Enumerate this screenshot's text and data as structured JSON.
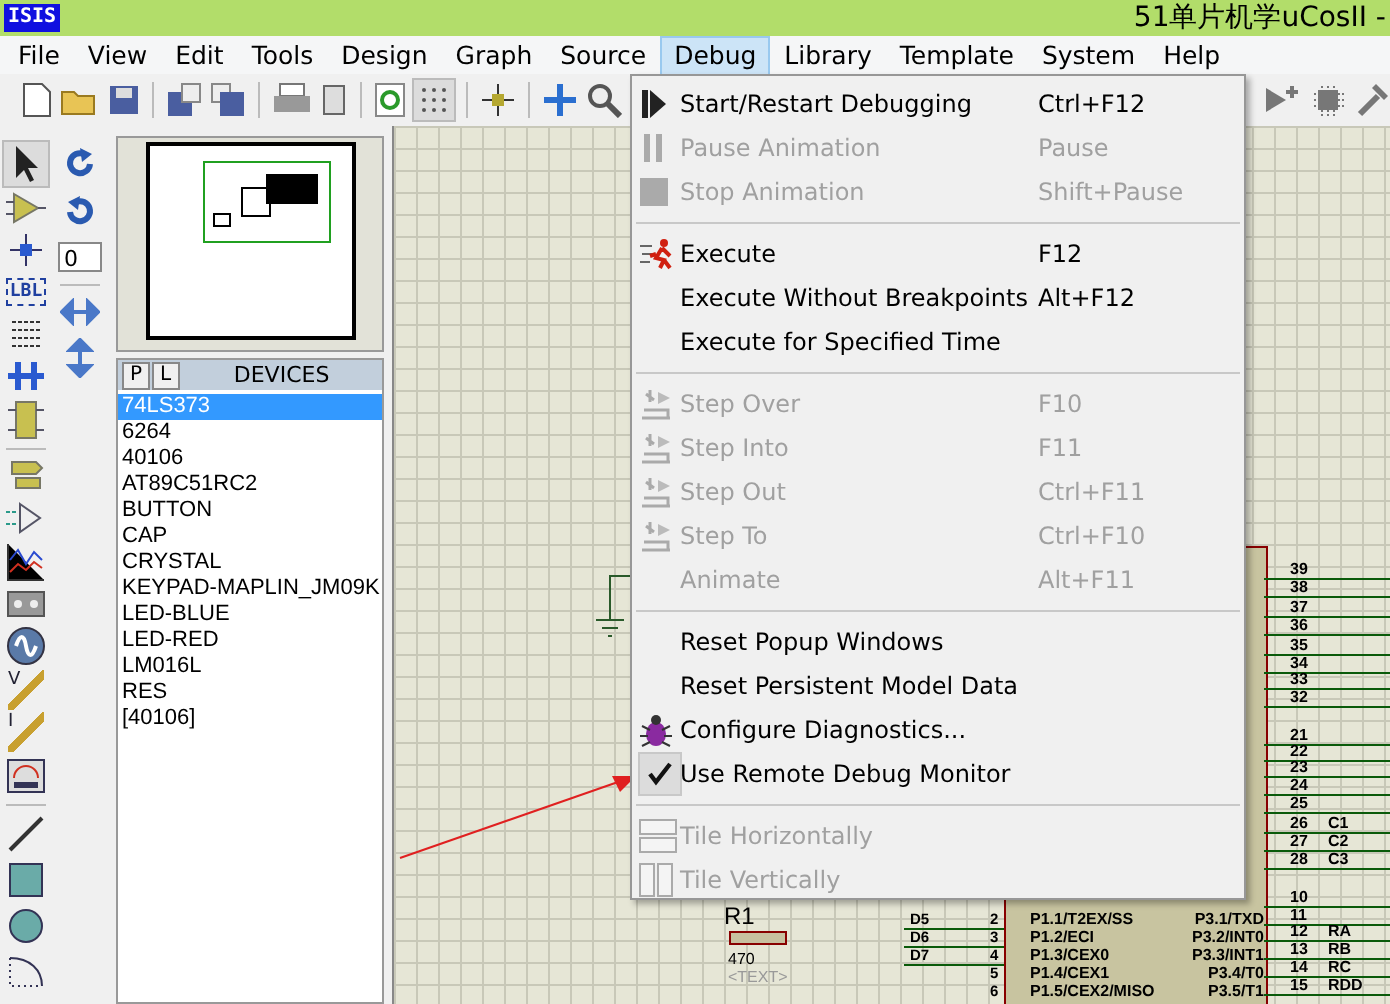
{
  "window": {
    "logo": "ISIS",
    "title": "51单片机学uCosII -"
  },
  "menus": [
    {
      "label": "File",
      "selected": false
    },
    {
      "label": "View",
      "selected": false
    },
    {
      "label": "Edit",
      "selected": false
    },
    {
      "label": "Tools",
      "selected": false
    },
    {
      "label": "Design",
      "selected": false
    },
    {
      "label": "Graph",
      "selected": false
    },
    {
      "label": "Source",
      "selected": false
    },
    {
      "label": "Debug",
      "selected": true
    },
    {
      "label": "Library",
      "selected": false
    },
    {
      "label": "Template",
      "selected": false
    },
    {
      "label": "System",
      "selected": false
    },
    {
      "label": "Help",
      "selected": false
    }
  ],
  "debug_menu": [
    {
      "kind": "item",
      "label": "Start/Restart Debugging",
      "shortcut": "Ctrl+F12",
      "disabled": false,
      "checked": false
    },
    {
      "kind": "item",
      "label": "Pause Animation",
      "shortcut": "Pause",
      "disabled": true,
      "checked": false
    },
    {
      "kind": "item",
      "label": "Stop Animation",
      "shortcut": "Shift+Pause",
      "disabled": true,
      "checked": false
    },
    {
      "kind": "separator"
    },
    {
      "kind": "item",
      "label": "Execute",
      "shortcut": "F12",
      "disabled": false,
      "checked": false
    },
    {
      "kind": "item",
      "label": "Execute Without Breakpoints",
      "shortcut": "Alt+F12",
      "disabled": false,
      "checked": false
    },
    {
      "kind": "item",
      "label": "Execute for Specified Time",
      "disabled": false,
      "checked": false
    },
    {
      "kind": "separator"
    },
    {
      "kind": "item",
      "label": "Step Over",
      "shortcut": "F10",
      "disabled": true,
      "checked": false
    },
    {
      "kind": "item",
      "label": "Step Into",
      "shortcut": "F11",
      "disabled": true,
      "checked": false
    },
    {
      "kind": "item",
      "label": "Step Out",
      "shortcut": "Ctrl+F11",
      "disabled": true,
      "checked": false
    },
    {
      "kind": "item",
      "label": "Step To",
      "shortcut": "Ctrl+F10",
      "disabled": true,
      "checked": false
    },
    {
      "kind": "item",
      "label": "Animate",
      "shortcut": "Alt+F11",
      "disabled": true,
      "checked": false
    },
    {
      "kind": "separator"
    },
    {
      "kind": "item",
      "label": "Reset Popup Windows",
      "disabled": false,
      "checked": false
    },
    {
      "kind": "item",
      "label": "Reset Persistent Model Data",
      "disabled": false,
      "checked": false
    },
    {
      "kind": "item",
      "label": "Configure Diagnostics...",
      "disabled": false,
      "checked": false
    },
    {
      "kind": "item",
      "label": "Use Remote Debug Monitor",
      "disabled": false,
      "checked": true
    },
    {
      "kind": "separator"
    },
    {
      "kind": "item",
      "label": "Tile Horizontally",
      "disabled": true,
      "checked": false
    },
    {
      "kind": "item",
      "label": "Tile Vertically",
      "disabled": true,
      "checked": false
    }
  ],
  "mode_tools": [
    {
      "label": "LBL"
    },
    {
      "label": "V"
    },
    {
      "label": "I"
    }
  ],
  "rotation": {
    "angle": "0"
  },
  "devices": {
    "tabs": [
      "P",
      "L"
    ],
    "title": "DEVICES",
    "items": [
      {
        "label": "74LS373",
        "selected": true
      },
      {
        "label": "6264",
        "selected": false
      },
      {
        "label": "40106",
        "selected": false
      },
      {
        "label": "AT89C51RC2",
        "selected": false
      },
      {
        "label": "BUTTON",
        "selected": false
      },
      {
        "label": "CAP",
        "selected": false
      },
      {
        "label": "CRYSTAL",
        "selected": false
      },
      {
        "label": "KEYPAD-MAPLIN_JM09K",
        "selected": false
      },
      {
        "label": "LED-BLUE",
        "selected": false
      },
      {
        "label": "LED-RED",
        "selected": false
      },
      {
        "label": "LM016L",
        "selected": false
      },
      {
        "label": "RES",
        "selected": false
      },
      {
        "label": "[40106]",
        "selected": false
      }
    ]
  },
  "schematic": {
    "right_pins": [
      {
        "num": "39"
      },
      {
        "num": "38"
      },
      {
        "num": "37"
      },
      {
        "num": "36"
      },
      {
        "num": "35"
      },
      {
        "num": "34"
      },
      {
        "num": "33"
      },
      {
        "num": "32"
      },
      {
        "num": "21"
      },
      {
        "num": "22"
      },
      {
        "num": "23"
      },
      {
        "num": "24"
      },
      {
        "num": "25"
      },
      {
        "num": "26",
        "net": "C1"
      },
      {
        "num": "27",
        "net": "C2"
      },
      {
        "num": "28",
        "net": "C3"
      },
      {
        "num": "10"
      },
      {
        "num": "11"
      },
      {
        "num": "12",
        "net": "RA"
      },
      {
        "num": "13",
        "net": "RB"
      },
      {
        "num": "14",
        "net": "RC"
      },
      {
        "num": "15",
        "net": "RDD"
      }
    ],
    "left_pins": [
      {
        "net": "D5",
        "num": "2",
        "name": "P1.1/T2EX/SS",
        "right_name": "P3.1/TXD"
      },
      {
        "net": "D6",
        "num": "3",
        "name": "P1.2/ECI",
        "right_name": "P3.2/INT0"
      },
      {
        "net": "D7",
        "num": "4",
        "name": "P1.3/CEX0",
        "right_name": "P3.3/INT1"
      },
      {
        "num": "5",
        "name": "P1.4/CEX1",
        "right_name": "P3.4/T0"
      },
      {
        "num": "6",
        "name": "P1.5/CEX2/MISO",
        "right_name": "P3.5/T1"
      }
    ],
    "resistor": {
      "ref": "R1",
      "value": "470",
      "text": "<TEXT>"
    }
  }
}
